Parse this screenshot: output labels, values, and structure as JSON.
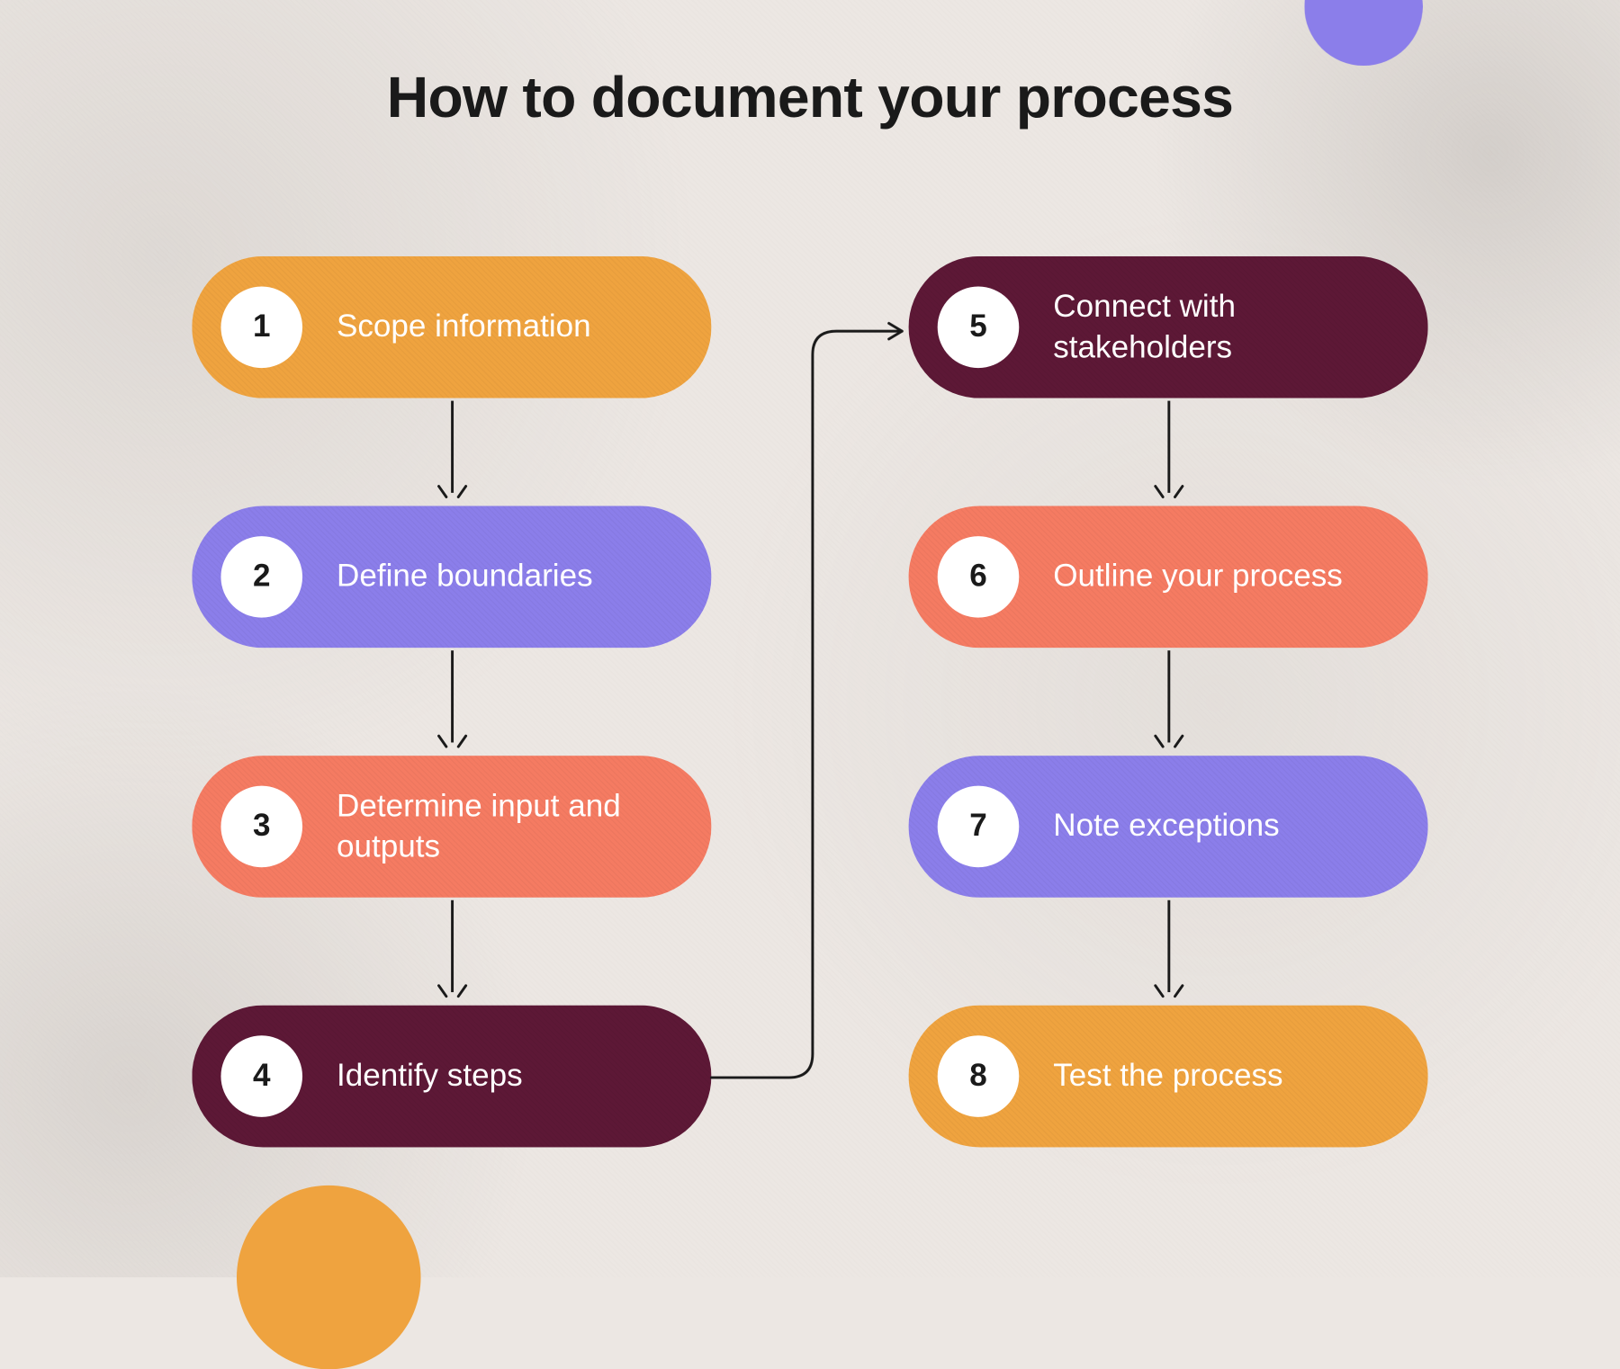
{
  "title": "How to document your process",
  "colors": {
    "orange": "#efa33f",
    "purple": "#8b7eea",
    "coral": "#f57b62",
    "maroon": "#5d1836",
    "bg": "#ece7e3",
    "text": "#1a1a1a"
  },
  "steps": {
    "left": [
      {
        "num": "1",
        "label": "Scope information",
        "color": "orange"
      },
      {
        "num": "2",
        "label": "Define boundaries",
        "color": "purple"
      },
      {
        "num": "3",
        "label": "Determine input and outputs",
        "color": "coral"
      },
      {
        "num": "4",
        "label": "Identify steps",
        "color": "maroon"
      }
    ],
    "right": [
      {
        "num": "5",
        "label": "Connect with stakeholders",
        "color": "maroon"
      },
      {
        "num": "6",
        "label": "Outline your process",
        "color": "coral"
      },
      {
        "num": "7",
        "label": "Note exceptions",
        "color": "purple"
      },
      {
        "num": "8",
        "label": "Test the process",
        "color": "orange"
      }
    ]
  }
}
